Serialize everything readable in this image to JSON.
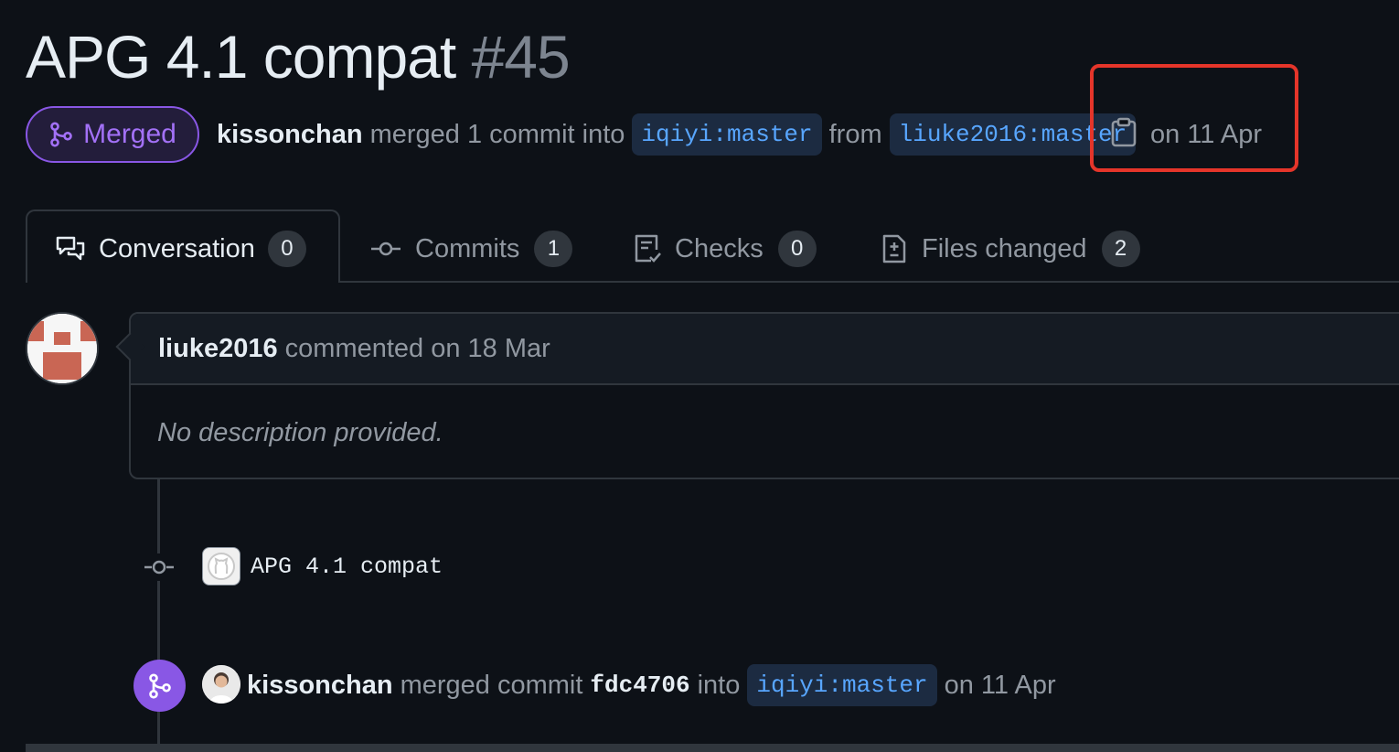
{
  "pr": {
    "title": "APG 4.1 compat",
    "number": "#45",
    "state": "Merged",
    "merger": "kissonchan",
    "merge_text": "merged 1 commit into",
    "base_branch": "iqiyi:master",
    "from_text": "from",
    "head_branch": "liuke2016:master",
    "merged_date": "on 11 Apr"
  },
  "tabs": [
    {
      "label": "Conversation",
      "count": "0",
      "icon": "comment-discussion-icon"
    },
    {
      "label": "Commits",
      "count": "1",
      "icon": "git-commit-icon"
    },
    {
      "label": "Checks",
      "count": "0",
      "icon": "checklist-icon"
    },
    {
      "label": "Files changed",
      "count": "2",
      "icon": "file-diff-icon"
    }
  ],
  "comment": {
    "author": "liuke2016",
    "action": "commented on 18 Mar",
    "body": "No description provided."
  },
  "commit": {
    "message": "APG 4.1 compat"
  },
  "merge_event": {
    "user": "kissonchan",
    "text": "merged commit",
    "sha": "fdc4706",
    "into": "into",
    "branch": "iqiyi:master",
    "date": "on 11 Apr"
  },
  "colors": {
    "background": "#0d1117",
    "merged_purple": "#8957e5",
    "link_blue": "#58a6ff",
    "highlight_red": "#e5352a"
  }
}
